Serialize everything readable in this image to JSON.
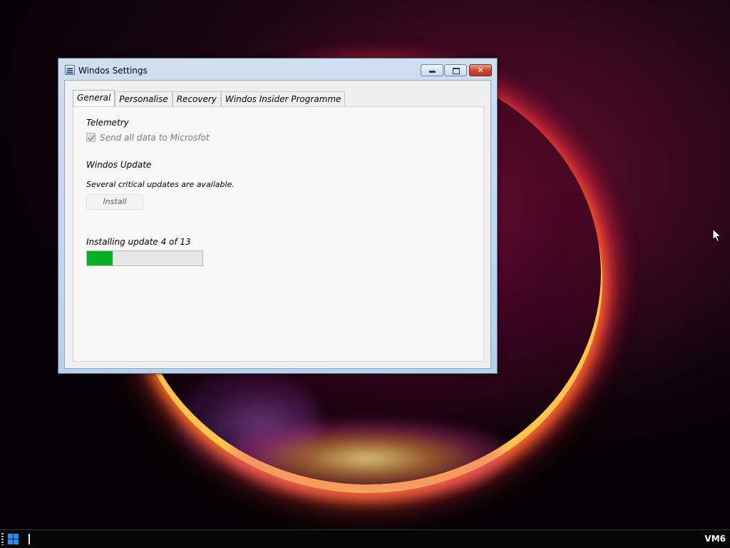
{
  "window": {
    "title": "Windos Settings",
    "buttons": {
      "minimize": "minimize",
      "maximize": "maximize",
      "close": "✕"
    }
  },
  "tabs": [
    {
      "label": "General",
      "active": true
    },
    {
      "label": "Personalise",
      "active": false
    },
    {
      "label": "Recovery",
      "active": false
    },
    {
      "label": "Windos Insider Programme",
      "active": false
    }
  ],
  "general": {
    "telemetry": {
      "heading": "Telemetry",
      "checkbox_label": "Send all data to Microsfot",
      "checked": true,
      "enabled": false
    },
    "update": {
      "heading": "Windos Update",
      "status": "Several critical updates are available.",
      "install_label": "Install",
      "install_enabled": false
    },
    "progress": {
      "label": "Installing update 4 of 13",
      "fraction": 0.22,
      "fill_color": "#06b025"
    }
  },
  "taskbar": {
    "start_icon": "windows-logo-icon",
    "label": "VM6"
  },
  "colors": {
    "accent": "#1e90ff",
    "progress": "#06b025",
    "close_button": "#c8442c"
  }
}
